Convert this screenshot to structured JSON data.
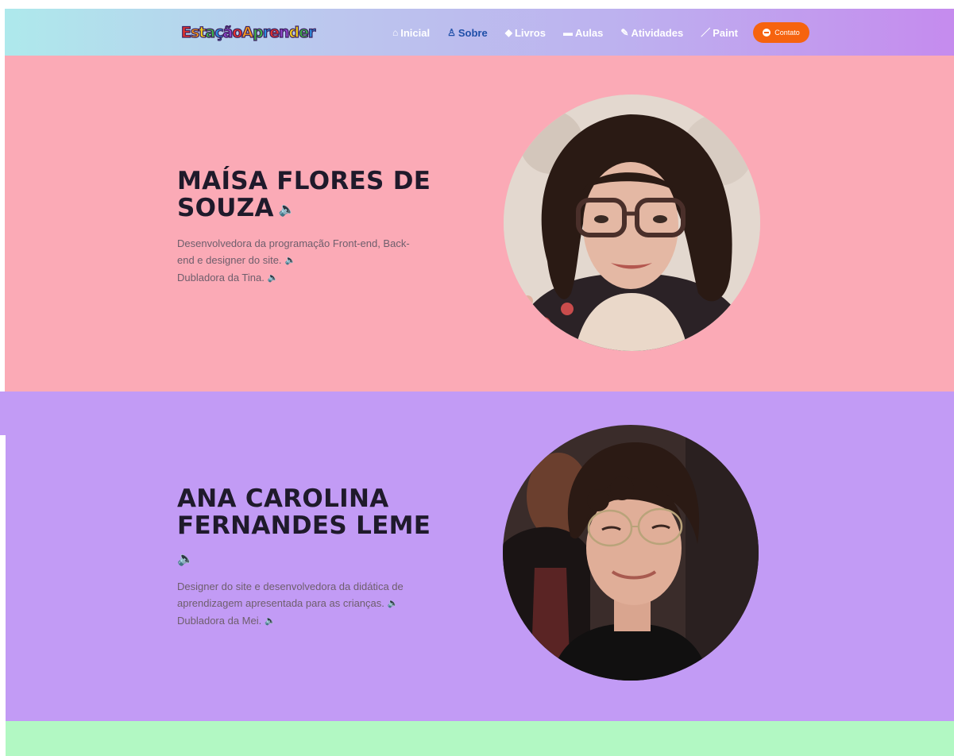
{
  "header": {
    "logo_letters": [
      "E",
      "s",
      "t",
      "a",
      "ç",
      "ã",
      "o",
      "A",
      "p",
      "r",
      "e",
      "n",
      "d",
      "e",
      "r"
    ],
    "logo_colors": [
      "#e8332a",
      "#f59b1a",
      "#f5d21a",
      "#3fb547",
      "#2a8fe0",
      "#8e44c9",
      "#e8332a",
      "#f59b1a",
      "#3fb547",
      "#2a8fe0",
      "#e8332a",
      "#8e44c9",
      "#f5d21a",
      "#3fb547",
      "#2a8fe0"
    ],
    "nav": [
      {
        "icon": "house-icon",
        "glyph": "⌂",
        "label": "Inicial",
        "active": false
      },
      {
        "icon": "person-icon",
        "glyph": "♙",
        "label": "Sobre",
        "active": true
      },
      {
        "icon": "graduation-cap-icon",
        "glyph": "◆",
        "label": "Livros",
        "active": false
      },
      {
        "icon": "chalkboard-icon",
        "glyph": "▬",
        "label": "Aulas",
        "active": false
      },
      {
        "icon": "notepad-icon",
        "glyph": "✎",
        "label": "Atividades",
        "active": false
      },
      {
        "icon": "brush-icon",
        "glyph": "／",
        "label": "Paint",
        "active": false
      }
    ],
    "contact_label": "Contato",
    "contact_color": "#f6630f"
  },
  "profiles": [
    {
      "name": "Maísa Flores de Souza",
      "description_lines": [
        "Desenvolvedora da programação Front-end, Back-end e designer do site.",
        "Dubladora da Tina."
      ],
      "background": "#fbaab6"
    },
    {
      "name": "Ana Carolina Fernandes Leme",
      "description_lines": [
        "Designer do site e desenvolvedora da didática de aprendizagem apresentada para as crianças.",
        "Dubladora da Mei."
      ],
      "background": "#c29bf5"
    }
  ],
  "speaker_glyph": "🔈"
}
